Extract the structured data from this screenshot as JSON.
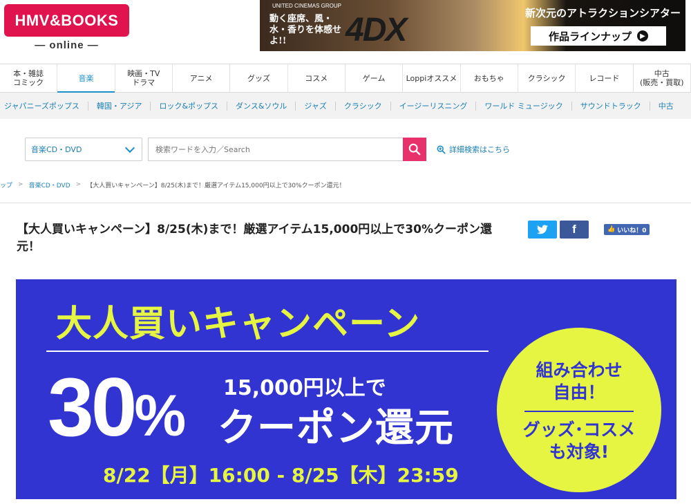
{
  "header": {
    "logo_main": "HMV&BOOKS",
    "logo_sub": "— online —",
    "ad": {
      "brand": "UNITED CINEMAS GROUP",
      "tagline": "動く座席、風・水・香りを体感せよ!!",
      "product": "4DX",
      "headline": "新次元のアトラクションシアター",
      "button_label": "作品ラインナップ"
    }
  },
  "nav": {
    "items": [
      {
        "label": "本・雑誌\nコミック"
      },
      {
        "label": "音楽"
      },
      {
        "label": "映画・TV\nドラマ"
      },
      {
        "label": "アニメ"
      },
      {
        "label": "グッズ"
      },
      {
        "label": "コスメ"
      },
      {
        "label": "ゲーム"
      },
      {
        "label": "Loppiオススメ"
      },
      {
        "label": "おもちゃ"
      },
      {
        "label": "クラシック"
      },
      {
        "label": "レコード"
      },
      {
        "label": "中古\n(販売・買取)"
      }
    ],
    "active_index": 1
  },
  "subnav": {
    "items": [
      {
        "label": "ジャパニーズポップス"
      },
      {
        "label": "韓国・アジア"
      },
      {
        "label": "ロック&ポップス"
      },
      {
        "label": "ダンス&ソウル"
      },
      {
        "label": "ジャズ"
      },
      {
        "label": "クラシック"
      },
      {
        "label": "イージーリスニング"
      },
      {
        "label": "ワールド ミュージック"
      },
      {
        "label": "サウンドトラック"
      },
      {
        "label": "中古"
      }
    ]
  },
  "search": {
    "category": "音楽CD・DVD",
    "placeholder": "検索ワードを入力／Search",
    "advanced_label": "詳細検索はこちら"
  },
  "breadcrumb": {
    "items": [
      "ップ",
      "音楽CD・DVD"
    ],
    "current": "【大人買いキャンペーン】8/25(木)まで！厳選アイテム15,000円以上で30%クーポン還元！"
  },
  "article": {
    "title": "【大人買いキャンペーン】8/25(木)まで！厳選アイテム15,000円以上で30%クーポン還元！",
    "like_label": "いいね！0"
  },
  "banner": {
    "headline": "大人買いキャンペーン",
    "percent": "30",
    "percent_sign": "%",
    "threshold": "15,000円以上で",
    "coupon": "クーポン還元",
    "period": "8/22【月】16:00 - 8/25【木】23:59",
    "circle_top": "組み合わせ\n自由！",
    "circle_bottom": "グッズ･コスメ\nも対象!"
  },
  "colors": {
    "brand_pink": "#e0134e",
    "link_blue": "#1a7fb5",
    "search_pink": "#e8306b",
    "banner_blue": "#3134d0",
    "banner_yellow": "#e5f542"
  }
}
